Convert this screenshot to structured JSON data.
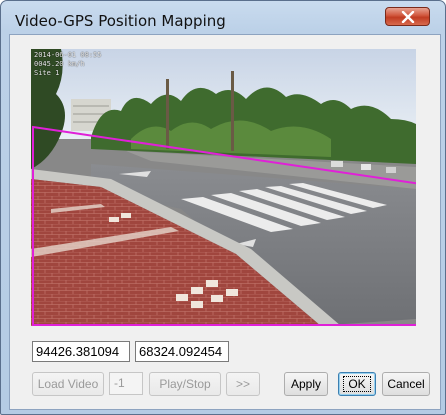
{
  "window": {
    "title": "Video-GPS Position Mapping"
  },
  "video": {
    "overlay_lines": [
      "2014-06-01 08:55",
      "0045.20 km/h",
      "Site 1"
    ]
  },
  "coords": {
    "x_value": "94426.381094",
    "y_value": "68324.092454"
  },
  "controls": {
    "load_video": "Load Video",
    "frame_number": "-1",
    "play_stop": "Play/Stop",
    "next": ">>",
    "apply": "Apply",
    "ok": "OK",
    "cancel": "Cancel"
  },
  "colors": {
    "roi_outline": "#e020d8",
    "titlebar": "#c9dbee",
    "close_button": "#c94a30"
  }
}
